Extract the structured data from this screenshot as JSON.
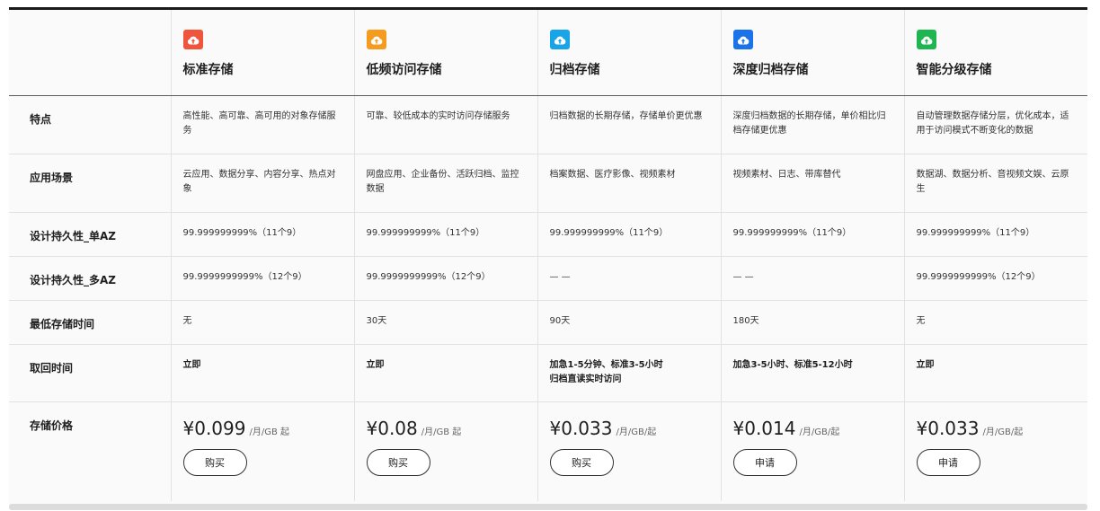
{
  "products": [
    {
      "name": "标准存储",
      "icon": "cloud-upload-icon",
      "color": "#f0553c",
      "feature": "高性能、高可靠、高可用的对象存储服务",
      "scene": "云应用、数据分享、内容分享、热点对象",
      "dur_single": "99.999999999%（11个9）",
      "dur_multi": "99.9999999999%（12个9）",
      "min_time": "无",
      "retrieval": "立即",
      "price": "¥0.099",
      "price_unit": "/月/GB 起",
      "button": "购买"
    },
    {
      "name": "低频访问存储",
      "icon": "cloud-upload-icon",
      "color": "#f59b1f",
      "feature": "可靠、较低成本的实时访问存储服务",
      "scene": "网盘应用、企业备份、活跃归档、监控数据",
      "dur_single": "99.999999999%（11个9）",
      "dur_multi": "99.9999999999%（12个9）",
      "min_time": "30天",
      "retrieval": "立即",
      "price": "¥0.08",
      "price_unit": "/月/GB 起",
      "button": "购买"
    },
    {
      "name": "归档存储",
      "icon": "cloud-upload-icon",
      "color": "#17a5e8",
      "feature": "归档数据的长期存储，存储单价更优惠",
      "scene": "档案数据、医疗影像、视频素材",
      "dur_single": "99.999999999%（11个9）",
      "dur_multi": "— —",
      "min_time": "90天",
      "retrieval": "加急1-5分钟、标准3-5小时\n归档直读实时访问",
      "price": "¥0.033",
      "price_unit": "/月/GB/起",
      "button": "购买"
    },
    {
      "name": "深度归档存储",
      "icon": "cloud-upload-icon",
      "color": "#1a73e8",
      "feature": "深度归档数据的长期存储，单价相比归档存储更优惠",
      "scene": "视频素材、日志、带库替代",
      "dur_single": "99.999999999%（11个9）",
      "dur_multi": "— —",
      "min_time": "180天",
      "retrieval": "加急3-5小时、标准5-12小时",
      "price": "¥0.014",
      "price_unit": "/月/GB/起",
      "button": "申请"
    },
    {
      "name": "智能分级存储",
      "icon": "cloud-upload-icon",
      "color": "#1fb652",
      "feature": "自动管理数据存储分层，优化成本，适用于访问模式不断变化的数据",
      "scene": "数据湖、数据分析、音视频文娱、云原生",
      "dur_single": "99.999999999%（11个9）",
      "dur_multi": "99.9999999999%（12个9）",
      "min_time": "无",
      "retrieval": "立即",
      "price": "¥0.033",
      "price_unit": "/月/GB/起",
      "button": "申请"
    }
  ],
  "row_labels": {
    "feature": "特点",
    "scene": "应用场景",
    "dur_single": "设计持久性_单AZ",
    "dur_multi": "设计持久性_多AZ",
    "min_time": "最低存储时间",
    "retrieval": "取回时间",
    "price": "存储价格"
  }
}
